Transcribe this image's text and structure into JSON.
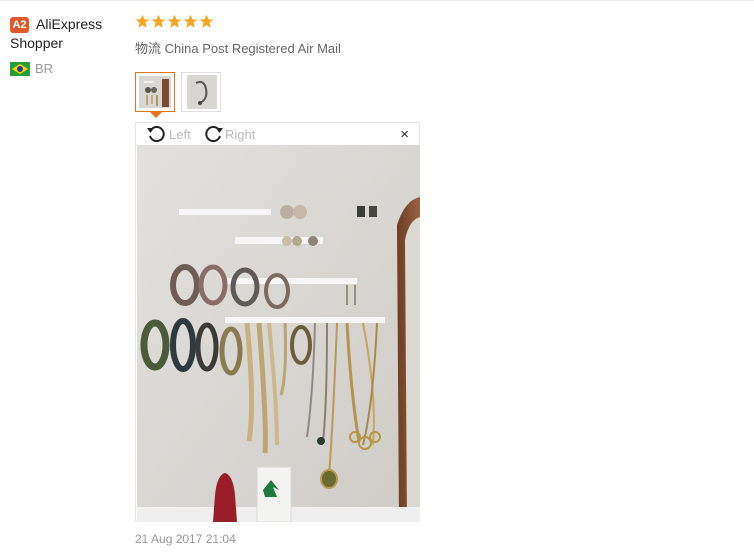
{
  "user": {
    "badge": "A2",
    "name": "AliExpress Shopper",
    "country": "BR"
  },
  "review": {
    "stars": 5,
    "shipping": "物流 China Post Registered Air Mail",
    "date": "21 Aug 2017 21:04"
  },
  "viewer": {
    "rotate_left_label": "Left",
    "rotate_right_label": "Right",
    "close_symbol": "×"
  },
  "colors": {
    "star": "#f5a623",
    "accent": "#e8751a",
    "badge": "#e0592a"
  },
  "icons": [
    "brazil-flag-icon",
    "star-icon",
    "rotate-left-icon",
    "rotate-right-icon",
    "close-icon"
  ]
}
